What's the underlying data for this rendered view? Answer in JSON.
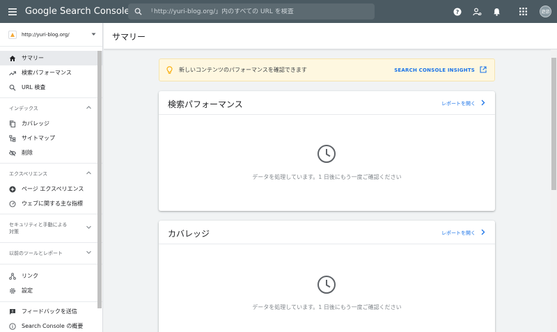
{
  "app": {
    "title": "Google Search Console",
    "search_placeholder": "「http://yuri-blog.org/」内のすべての URL を検査",
    "avatar_initials": "遊游"
  },
  "sidebar": {
    "property": "http://yuri-blog.org/",
    "items_top": [
      {
        "label": "サマリー",
        "icon": "home-icon",
        "active": true
      },
      {
        "label": "検索パフォーマンス",
        "icon": "trending-up-icon"
      },
      {
        "label": "URL 検査",
        "icon": "search-icon"
      }
    ],
    "section_index": "インデックス",
    "items_index": [
      {
        "label": "カバレッジ",
        "icon": "file-copy-icon"
      },
      {
        "label": "サイトマップ",
        "icon": "sitemap-icon"
      },
      {
        "label": "削除",
        "icon": "eye-off-icon"
      }
    ],
    "section_experience": "エクスペリエンス",
    "items_experience": [
      {
        "label": "ページ エクスペリエンス",
        "icon": "plus-circle-icon"
      },
      {
        "label": "ウェブに関する主な指標",
        "icon": "gauge-icon"
      }
    ],
    "section_security_line1": "セキュリティと手動による",
    "section_security_line2": "対策",
    "section_legacy": "以前のツールとレポート",
    "items_bottom": [
      {
        "label": "リンク",
        "icon": "links-icon"
      },
      {
        "label": "設定",
        "icon": "gear-icon"
      }
    ],
    "items_footer": [
      {
        "label": "フィードバックを送信",
        "icon": "feedback-icon"
      },
      {
        "label": "Search Console の概要",
        "icon": "info-icon"
      }
    ]
  },
  "main": {
    "page_title": "サマリー",
    "banner": {
      "text": "新しいコンテンツのパフォーマンスを確認できます",
      "link": "SEARCH CONSOLE INSIGHTS"
    },
    "cards": [
      {
        "title": "検索パフォーマンス",
        "link": "レポートを開く",
        "message": "データを処理しています。1 日後にもう一度ご確認ください"
      },
      {
        "title": "カバレッジ",
        "link": "レポートを開く",
        "message": "データを処理しています。1 日後にもう一度ご確認ください"
      }
    ]
  },
  "colors": {
    "topbar": "#4b5a62",
    "link_blue": "#1a73e8",
    "banner_bg": "#fef7e0"
  }
}
